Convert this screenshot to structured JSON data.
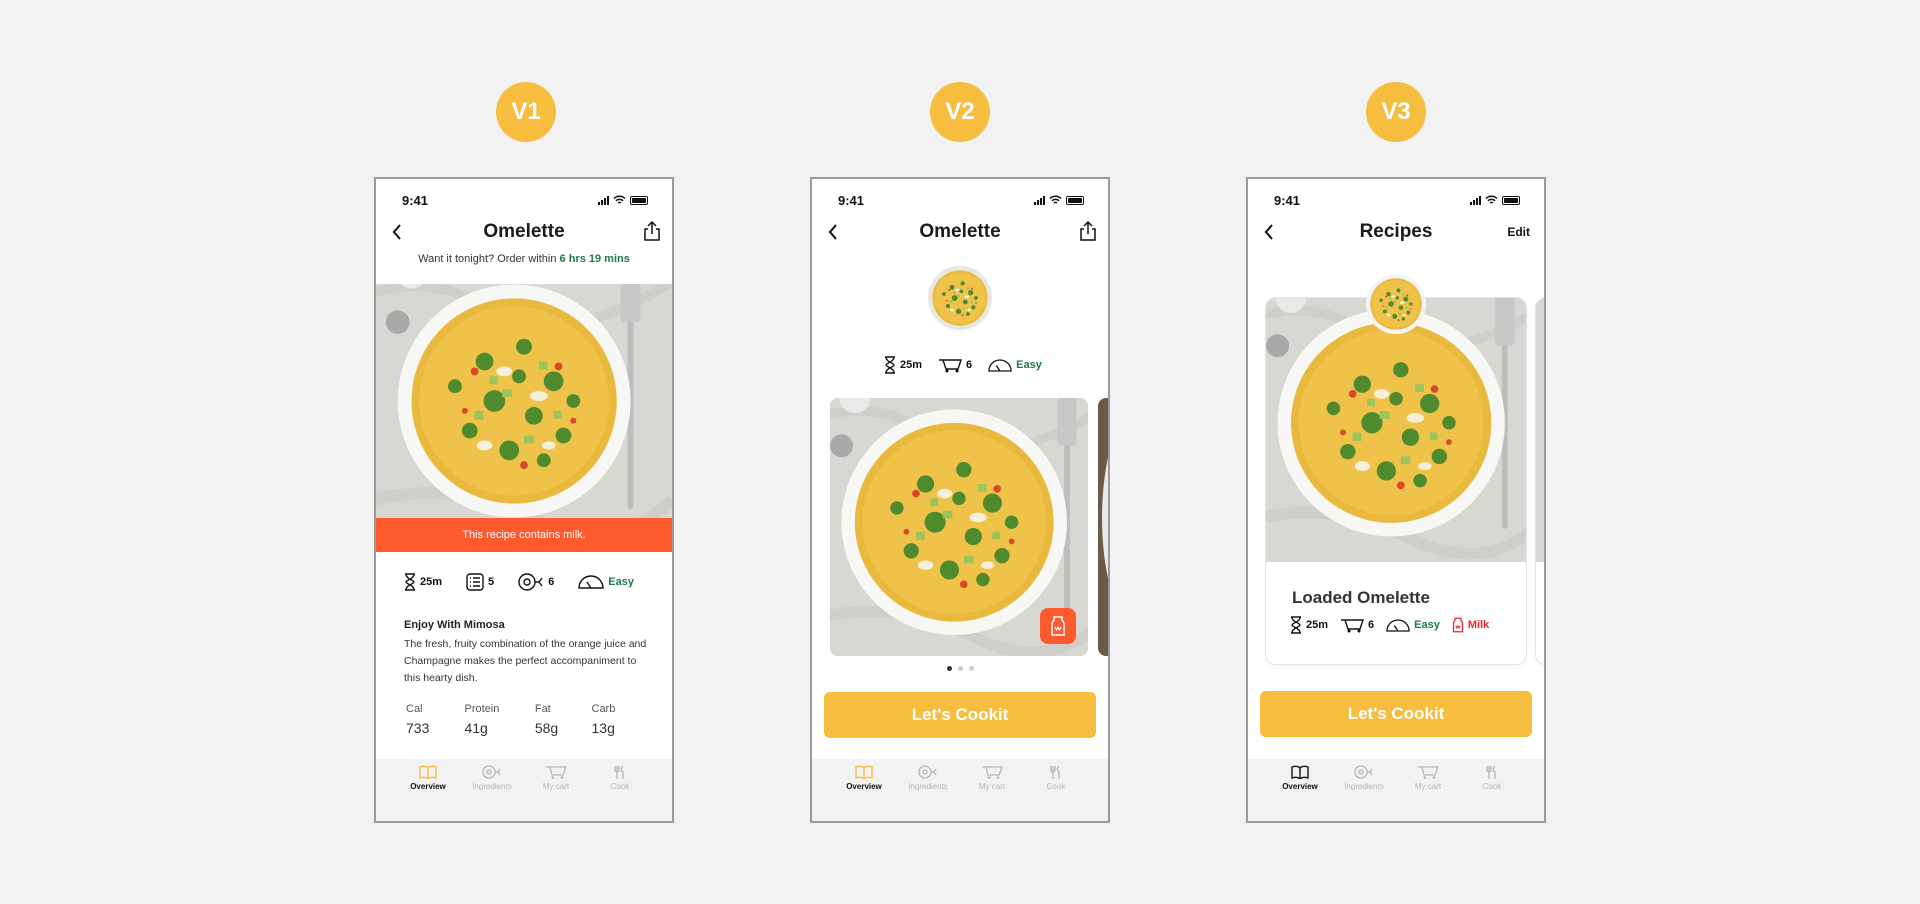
{
  "badges": [
    "V1",
    "V2",
    "V3"
  ],
  "status_time": "9:41",
  "tabs": [
    "Overview",
    "Ingredients",
    "My cart",
    "Cook"
  ],
  "v1": {
    "title": "Omelette",
    "order_prefix": "Want it tonight? Order within ",
    "order_time": "6 hrs 19 mins",
    "allergy": "This recipe contains milk.",
    "time": "25m",
    "steps": "5",
    "ingredients": "6",
    "difficulty": "Easy",
    "desc_title": "Enjoy With Mimosa",
    "desc_body": "The fresh, fruity combination of the orange juice and Champagne makes the perfect accompaniment to this hearty dish.",
    "nutrition": [
      {
        "label": "Cal",
        "value": "733"
      },
      {
        "label": "Protein",
        "value": "41g"
      },
      {
        "label": "Fat",
        "value": "58g"
      },
      {
        "label": "Carb",
        "value": "13g"
      }
    ]
  },
  "v2": {
    "title": "Omelette",
    "time": "25m",
    "ingredients": "6",
    "difficulty": "Easy",
    "cta": "Let's Cookit",
    "carousel": {
      "active": 1,
      "total": 3
    }
  },
  "v3": {
    "title": "Recipes",
    "edit": "Edit",
    "card_title": "Loaded Omelette",
    "time": "25m",
    "ingredients": "6",
    "difficulty": "Easy",
    "allergen": "Milk",
    "cta": "Let's Cookit"
  },
  "colors": {
    "accent": "#f6bd3f",
    "alert": "#ff5a2e",
    "easy": "#1f7a4a",
    "milk": "#e8262b"
  }
}
